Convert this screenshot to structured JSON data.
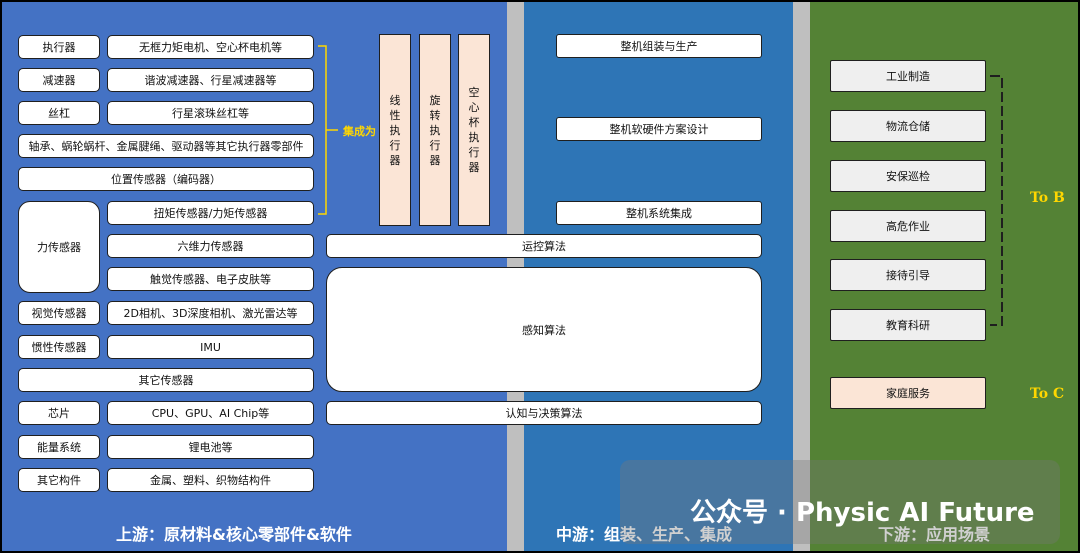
{
  "upstream": {
    "footer": "上游：原材料&核心零部件&软件",
    "rows": [
      {
        "cat": "执行器",
        "desc": "无框力矩电机、空心杯电机等"
      },
      {
        "cat": "减速器",
        "desc": "谐波减速器、行星减速器等"
      },
      {
        "cat": "丝杠",
        "desc": "行星滚珠丝杠等"
      }
    ],
    "bearing": "轴承、蜗轮蜗杆、金属腱绳、驱动器等其它执行器零部件",
    "position_sensor": "位置传感器（编码器）",
    "force_sensor": {
      "cat": "力传感器",
      "items": [
        "扭矩传感器/力矩传感器",
        "六维力传感器",
        "触觉传感器、电子皮肤等"
      ]
    },
    "vision": {
      "cat": "视觉传感器",
      "desc": "2D相机、3D深度相机、激光雷达等"
    },
    "inertial": {
      "cat": "惯性传感器",
      "desc": "IMU"
    },
    "other_sensor": "其它传感器",
    "chip": {
      "cat": "芯片",
      "desc": "CPU、GPU、AI Chip等"
    },
    "energy": {
      "cat": "能量系统",
      "desc": "锂电池等"
    },
    "other_parts": {
      "cat": "其它构件",
      "desc": "金属、塑料、织物结构件"
    },
    "integrate_label": "集成为",
    "actuators": [
      "线性执行器",
      "旋转执行器",
      "空心杯执行器"
    ],
    "algorithms": {
      "motion": "运控算法",
      "perception": "感知算法",
      "decision": "认知与决策算法"
    }
  },
  "midstream": {
    "footer": "中游：组装、生产、集成",
    "boxes": [
      "整机组装与生产",
      "整机软硬件方案设计",
      "整机系统集成"
    ]
  },
  "downstream": {
    "footer": "下游：应用场景",
    "to_b_items": [
      "工业制造",
      "物流仓储",
      "安保巡检",
      "高危作业",
      "接待引导",
      "教育科研"
    ],
    "to_c_items": [
      "家庭服务"
    ],
    "to_b_label": "To B",
    "to_c_label": "To C"
  },
  "watermark": "公众号 · Physic AI Future",
  "colors": {
    "upstream": "#4472c4",
    "midstream": "#2e75b6",
    "downstream": "#548235",
    "accent": "#ffd700",
    "peach": "#fbe5d6"
  }
}
